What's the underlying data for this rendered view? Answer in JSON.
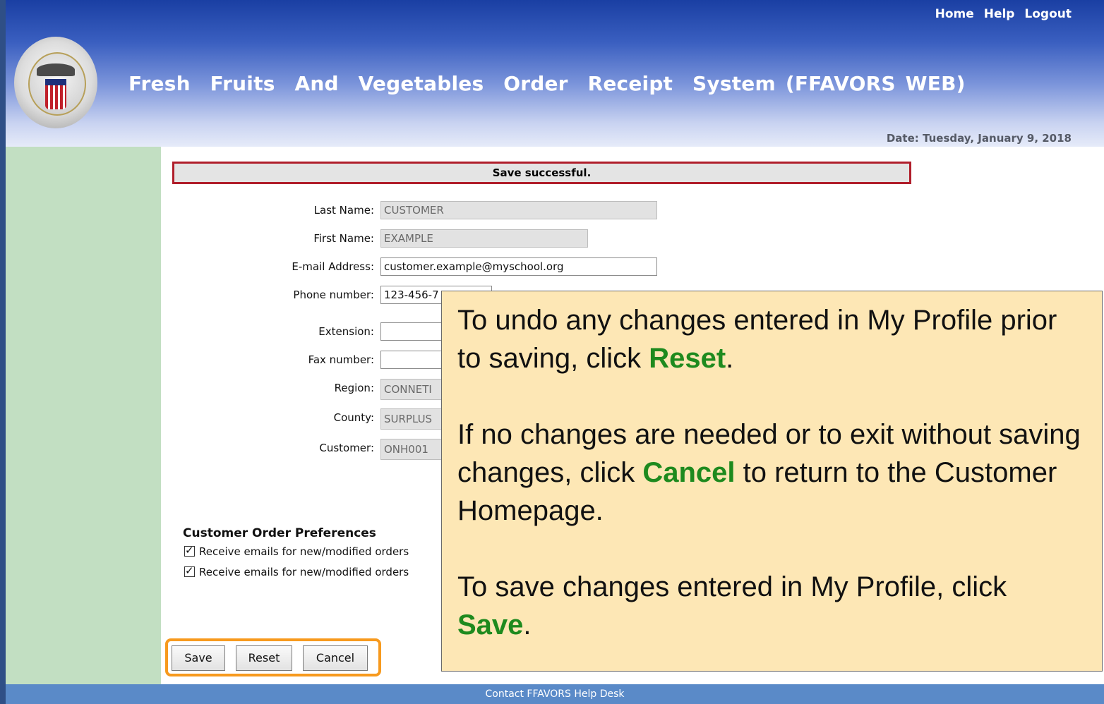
{
  "header": {
    "nav": [
      "Home",
      "Help",
      "Logout"
    ],
    "title": "Fresh  Fruits  And  Vegetables  Order  Receipt  System (FFAVORS WEB)",
    "date_label": "Date:",
    "date_value": "Tuesday, January 9, 2018",
    "logo_icon": "dla-seal-logo"
  },
  "message": "Save successful.",
  "form": {
    "last_name": {
      "label": "Last Name:",
      "value": "CUSTOMER"
    },
    "first_name": {
      "label": "First Name:",
      "value": "EXAMPLE"
    },
    "email": {
      "label": "E-mail Address:",
      "value": "customer.example@myschool.org"
    },
    "phone": {
      "label": "Phone number:",
      "value": "123-456-7"
    },
    "extension": {
      "label": "Extension:",
      "value": ""
    },
    "fax": {
      "label": "Fax number:",
      "value": ""
    },
    "region": {
      "label": "Region:",
      "value": "CONNETI"
    },
    "county": {
      "label": "County:",
      "value": "SURPLUS"
    },
    "customer": {
      "label": "Customer:",
      "value": "ONH001"
    }
  },
  "preferences": {
    "title": "Customer Order Preferences",
    "items": [
      {
        "label": "Receive emails for new/modified orders",
        "checked": true
      },
      {
        "label": "Receive emails for new/modified orders",
        "checked": true
      }
    ]
  },
  "buttons": {
    "save": "Save",
    "reset": "Reset",
    "cancel": "Cancel"
  },
  "callout": {
    "p1_pre": "To undo any changes entered in My Profile prior to saving, click ",
    "p1_em": "Reset",
    "p1_post": ".",
    "p2_pre": "If no changes are needed or to exit without saving changes, click ",
    "p2_em": "Cancel",
    "p2_post": " to return to the Customer Homepage.",
    "p3_pre": "To save changes entered in My Profile, click ",
    "p3_em": "Save",
    "p3_post": "."
  },
  "footer": "Contact FFAVORS Help Desk",
  "colors": {
    "header_blue": "#1a3fa3",
    "panel_green": "#c2dfc2",
    "error_border": "#b01e2b",
    "highlight_orange": "#f79a1e",
    "callout_bg": "#fde7b5",
    "callout_emphasis": "#1e8a1e",
    "footer_blue": "#5a8ac8"
  }
}
